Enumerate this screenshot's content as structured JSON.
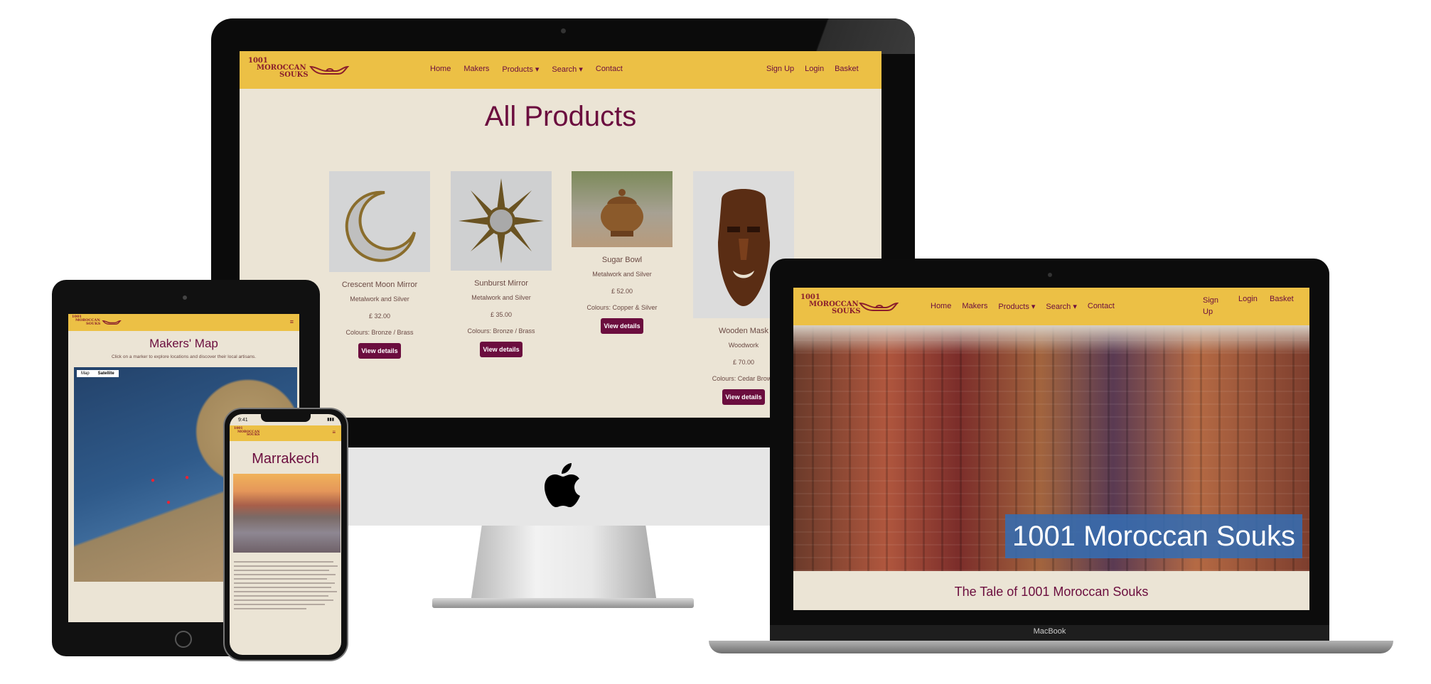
{
  "site": {
    "logo_line1": "1001",
    "logo_line2": "MOROCCAN",
    "logo_line3": "SOUKS",
    "nav": {
      "home": "Home",
      "makers": "Makers",
      "products": "Products",
      "search": "Search",
      "contact": "Contact",
      "signup": "Sign Up",
      "signup_a": "Sign",
      "signup_b": "Up",
      "login": "Login",
      "basket": "Basket"
    }
  },
  "imac": {
    "page_title": "All Products",
    "products": [
      {
        "name": "Crescent Moon Mirror",
        "category": "Metalwork and Silver",
        "price": "£ 32.00",
        "colours": "Colours: Bronze / Brass",
        "button": "View details"
      },
      {
        "name": "Sunburst Mirror",
        "category": "Metalwork and Silver",
        "price": "£ 35.00",
        "colours": "Colours: Bronze / Brass",
        "button": "View details"
      },
      {
        "name": "Sugar Bowl",
        "category": "Metalwork and Silver",
        "price": "£ 52.00",
        "colours": "Colours: Copper & Silver",
        "button": "View details"
      },
      {
        "name": "Wooden Mask",
        "category": "Woodwork",
        "price": "£ 70.00",
        "colours": "Colours: Cedar Brown",
        "button": "View details"
      }
    ]
  },
  "tablet": {
    "title": "Makers' Map",
    "subtitle": "Click on a marker to explore locations and discover their local artisans.",
    "map_tab_map": "Map",
    "map_tab_satellite": "Satellite"
  },
  "phone": {
    "time": "9:41",
    "title": "Marrakech"
  },
  "laptop": {
    "hero_title": "1001 Moroccan Souks",
    "section_title": "The Tale of 1001 Moroccan Souks",
    "brand": "MacBook"
  },
  "colors": {
    "nav_yellow": "#ecc045",
    "cream": "#ebe4d5",
    "plum": "#6b0d3e"
  }
}
